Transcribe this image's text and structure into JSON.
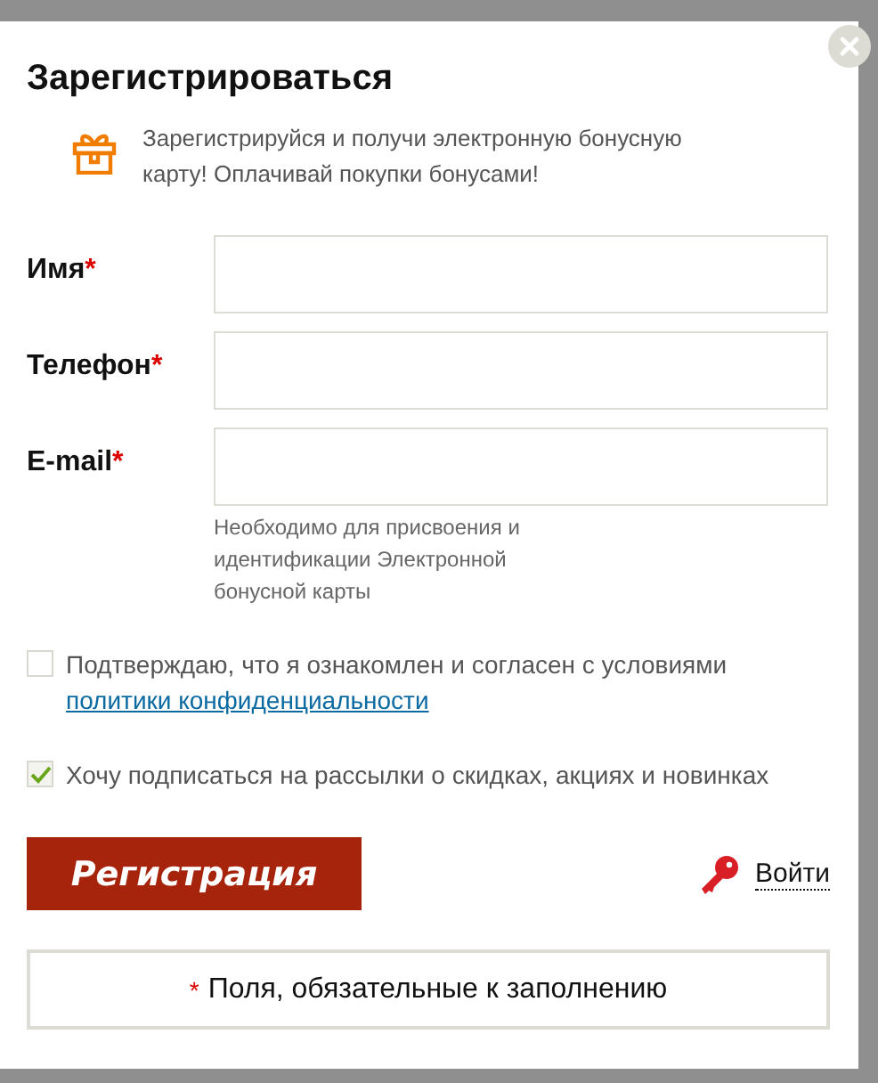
{
  "dialog": {
    "title": "Зарегистрироваться",
    "promo": "Зарегистрируйся и получи электронную бонусную карту! Оплачивай покупки бонусами!"
  },
  "fields": [
    {
      "label": "Имя",
      "required_mark": "*"
    },
    {
      "label": "Телефон",
      "required_mark": "*"
    },
    {
      "label": "E-mail",
      "required_mark": "*",
      "hint": "Необходимо для присвоения и идентификации Электронной бонусной карты"
    }
  ],
  "checkboxes": [
    {
      "text": "Подтверждаю, что я ознакомлен и согласен с условиями",
      "link": "политики конфиденциальности",
      "checked": false
    },
    {
      "text": "Хочу подписаться на рассылки о скидках, акциях и новинках",
      "checked": true
    }
  ],
  "submit": "Регистрация",
  "login": "Войти",
  "footer": {
    "mark": "*",
    "text": "Поля, обязательные к заполнению"
  }
}
